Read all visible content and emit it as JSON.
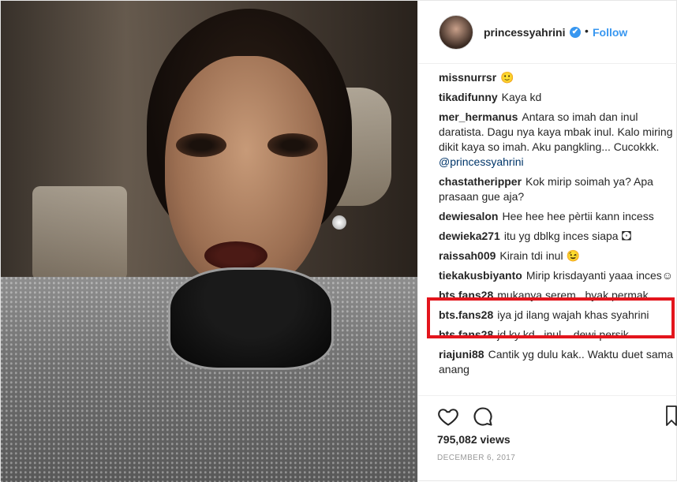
{
  "post": {
    "username": "princessyahrini",
    "separator": "•",
    "follow_label": "Follow",
    "verified_mark": "✔"
  },
  "comments": [
    {
      "user": "missnurrsr",
      "text": "🙂"
    },
    {
      "user": "tikadifunny",
      "text": "Kaya kd"
    },
    {
      "user": "mer_hermanus",
      "text": "Antara so imah dan inul daratista. Dagu nya kaya mbak inul. Kalo miring dikit kaya so imah. Aku pangkling... Cucokkk. ",
      "mention": "@princessyahrini"
    },
    {
      "user": "chastatheripper",
      "text": "Kok mirip soimah ya? Apa prasaan gue aja?"
    },
    {
      "user": "dewiesalon",
      "text": "Hee hee hee pèrtii kann incess"
    },
    {
      "user": "dewieka271",
      "text": "itu yg dblkg inces siapa 🖸"
    },
    {
      "user": "raissah009",
      "text": "Kirain tdi inul 😉"
    },
    {
      "user": "tiekakusbiyanto",
      "text": "Mirip krisdayanti yaaa inces☺"
    },
    {
      "user": "bts.fans28",
      "text": "mukanya serem.. byak permak"
    },
    {
      "user": "bts.fans28",
      "text": "iya jd ilang wajah khas syahrini"
    },
    {
      "user": "bts.fans28",
      "text": "jd ky kd.. inul... dewi persik"
    },
    {
      "user": "riajuni88",
      "text": "Cantik yg dulu kak.. Waktu duet sama anang"
    }
  ],
  "stats": {
    "views": "795,082 views",
    "date": "DECEMBER 6, 2017"
  },
  "colors": {
    "accent": "#3897f0",
    "highlight": "#e3151c"
  },
  "icons": {
    "like": "heart-icon",
    "comment": "comment-bubble-icon",
    "save": "bookmark-icon"
  }
}
